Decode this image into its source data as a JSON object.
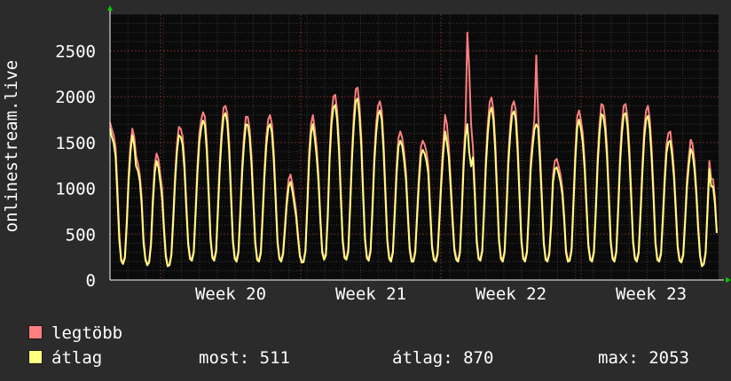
{
  "chart_data": {
    "type": "line",
    "title": "",
    "ylabel": "onlinestream.live",
    "xlabel": "",
    "ylim": [
      0,
      2900
    ],
    "yticks": [
      0,
      500,
      1000,
      1500,
      2000,
      2500
    ],
    "xtick_labels": [
      "Week 20",
      "Week 21",
      "Week 22",
      "Week 23"
    ],
    "grid": true,
    "series": [
      {
        "name": "legtöbb",
        "color": "#ff7f7f",
        "values": [
          1720,
          1640,
          1580,
          1450,
          1000,
          500,
          230,
          185,
          260,
          650,
          1150,
          1480,
          1650,
          1560,
          1350,
          1270,
          1150,
          900,
          450,
          240,
          170,
          200,
          420,
          900,
          1250,
          1380,
          1320,
          1150,
          1000,
          600,
          280,
          160,
          170,
          290,
          700,
          1150,
          1480,
          1670,
          1650,
          1570,
          1300,
          850,
          420,
          250,
          230,
          320,
          780,
          1250,
          1600,
          1750,
          1830,
          1780,
          1500,
          1000,
          480,
          260,
          230,
          330,
          820,
          1300,
          1650,
          1880,
          1900,
          1820,
          1500,
          980,
          450,
          250,
          220,
          320,
          780,
          1250,
          1580,
          1780,
          1780,
          1650,
          1350,
          900,
          430,
          240,
          220,
          310,
          730,
          1200,
          1560,
          1750,
          1800,
          1700,
          1400,
          940,
          440,
          250,
          220,
          300,
          600,
          900,
          1100,
          1150,
          1050,
          900,
          750,
          500,
          280,
          200,
          210,
          330,
          850,
          1400,
          1700,
          1800,
          1650,
          1450,
          1150,
          700,
          320,
          240,
          290,
          750,
          1400,
          1800,
          2000,
          2020,
          1850,
          1500,
          960,
          450,
          260,
          240,
          340,
          850,
          1400,
          1800,
          2080,
          2100,
          1900,
          1550,
          1000,
          470,
          260,
          230,
          330,
          800,
          1350,
          1700,
          1900,
          1950,
          1850,
          1500,
          980,
          450,
          250,
          220,
          320,
          780,
          1250,
          1550,
          1620,
          1550,
          1400,
          1180,
          760,
          360,
          220,
          220,
          320,
          750,
          1150,
          1450,
          1520,
          1480,
          1400,
          1250,
          800,
          380,
          240,
          220,
          300,
          720,
          1150,
          1480,
          1800,
          1700,
          1450,
          1100,
          700,
          350,
          240,
          220,
          320,
          800,
          1350,
          1700,
          2700,
          2300,
          1700,
          1450,
          1000,
          460,
          250,
          230,
          330,
          820,
          1350,
          1700,
          1940,
          1990,
          1850,
          1500,
          980,
          450,
          250,
          220,
          320,
          800,
          1350,
          1680,
          1900,
          1950,
          1850,
          1500,
          980,
          450,
          250,
          220,
          320,
          780,
          1300,
          1550,
          1750,
          2450,
          1800,
          1400,
          930,
          430,
          240,
          220,
          300,
          650,
          1150,
          1300,
          1320,
          1240,
          1150,
          1000,
          700,
          330,
          220,
          230,
          350,
          880,
          1400,
          1780,
          1850,
          1750,
          1600,
          1300,
          850,
          400,
          240,
          220,
          320,
          800,
          1350,
          1700,
          1920,
          1900,
          1750,
          1450,
          950,
          440,
          250,
          220,
          320,
          800,
          1350,
          1700,
          1900,
          1920,
          1780,
          1450,
          960,
          440,
          250,
          220,
          310,
          760,
          1250,
          1650,
          1850,
          1900,
          1750,
          1420,
          960,
          430,
          240,
          220,
          300,
          700,
          1150,
          1480,
          1600,
          1620,
          1450,
          1200,
          800,
          380,
          230,
          210,
          290,
          680,
          1100,
          1350,
          1530,
          1480,
          1300,
          1000,
          600,
          280,
          160,
          180,
          310,
          800,
          1300,
          1100,
          1100,
          900,
          520
        ],
        "values_note": ""
      },
      {
        "name": "átlag",
        "color": "#ffff80",
        "values": [
          1650,
          1560,
          1490,
          1350,
          900,
          430,
          210,
          175,
          240,
          600,
          1080,
          1400,
          1580,
          1470,
          1240,
          1190,
          1080,
          820,
          400,
          220,
          160,
          190,
          380,
          830,
          1170,
          1300,
          1230,
          1070,
          900,
          540,
          250,
          150,
          160,
          270,
          650,
          1080,
          1400,
          1580,
          1560,
          1480,
          1210,
          780,
          390,
          230,
          210,
          300,
          720,
          1170,
          1500,
          1660,
          1740,
          1690,
          1400,
          930,
          440,
          240,
          210,
          310,
          760,
          1220,
          1560,
          1780,
          1820,
          1720,
          1410,
          910,
          420,
          230,
          200,
          300,
          720,
          1170,
          1490,
          1700,
          1690,
          1560,
          1260,
          830,
          400,
          220,
          200,
          290,
          670,
          1120,
          1470,
          1660,
          1700,
          1610,
          1310,
          870,
          410,
          230,
          200,
          280,
          540,
          830,
          1020,
          1070,
          970,
          830,
          690,
          460,
          260,
          190,
          195,
          310,
          790,
          1310,
          1600,
          1700,
          1550,
          1350,
          1070,
          650,
          300,
          220,
          270,
          690,
          1320,
          1700,
          1880,
          1910,
          1750,
          1410,
          890,
          420,
          240,
          220,
          310,
          790,
          1320,
          1700,
          1950,
          1980,
          1790,
          1450,
          920,
          440,
          240,
          210,
          310,
          740,
          1270,
          1600,
          1800,
          1850,
          1750,
          1400,
          910,
          420,
          230,
          200,
          300,
          720,
          1170,
          1460,
          1520,
          1460,
          1310,
          1100,
          700,
          330,
          200,
          200,
          300,
          690,
          1070,
          1350,
          1420,
          1380,
          1300,
          1160,
          740,
          350,
          220,
          200,
          280,
          660,
          1060,
          1380,
          1620,
          1500,
          1340,
          1010,
          640,
          320,
          220,
          200,
          300,
          740,
          1260,
          1560,
          1700,
          1400,
          1240,
          1340,
          920,
          420,
          230,
          210,
          310,
          760,
          1260,
          1600,
          1820,
          1880,
          1750,
          1400,
          910,
          420,
          230,
          200,
          300,
          740,
          1260,
          1580,
          1800,
          1840,
          1750,
          1400,
          910,
          420,
          230,
          200,
          300,
          720,
          1200,
          1450,
          1640,
          1700,
          1660,
          1300,
          860,
          400,
          220,
          200,
          280,
          600,
          1070,
          1210,
          1230,
          1160,
          1070,
          930,
          650,
          300,
          200,
          210,
          320,
          820,
          1310,
          1660,
          1750,
          1650,
          1500,
          1210,
          790,
          370,
          220,
          200,
          300,
          740,
          1260,
          1600,
          1810,
          1790,
          1650,
          1350,
          880,
          410,
          230,
          200,
          300,
          740,
          1260,
          1600,
          1800,
          1820,
          1680,
          1350,
          890,
          410,
          230,
          200,
          290,
          700,
          1160,
          1550,
          1750,
          1790,
          1650,
          1320,
          890,
          400,
          220,
          200,
          280,
          650,
          1070,
          1390,
          1500,
          1520,
          1360,
          1120,
          740,
          350,
          210,
          190,
          270,
          630,
          1020,
          1260,
          1430,
          1380,
          1210,
          930,
          550,
          260,
          150,
          170,
          290,
          740,
          1210,
          1020,
          1020,
          830,
          511
        ]
      }
    ]
  },
  "legend": {
    "items": [
      {
        "label": "legtöbb",
        "color": "#ff7f7f"
      },
      {
        "label": "átlag",
        "color": "#ffff80"
      }
    ],
    "stats": {
      "now": "most: 511",
      "avg": "átlag: 870",
      "max": "max: 2053"
    }
  },
  "colors": {
    "background": "#2b2b2b",
    "plot_background": "#0a0a0a",
    "grid_minor": "#3a3a3a",
    "grid_major": "#6a2a2a",
    "axis": "#ffffff",
    "arrow": "#00cc00"
  }
}
